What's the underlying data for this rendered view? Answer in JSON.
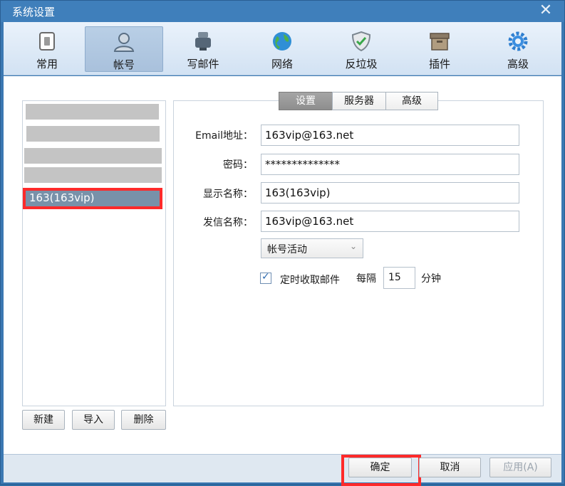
{
  "window": {
    "title": "系统设置"
  },
  "toolbar": {
    "items": [
      {
        "label": "常用",
        "icon": "switch-icon"
      },
      {
        "label": "帐号",
        "icon": "user-icon"
      },
      {
        "label": "写邮件",
        "icon": "pen-icon"
      },
      {
        "label": "网络",
        "icon": "globe-icon"
      },
      {
        "label": "反垃圾",
        "icon": "shield-icon"
      },
      {
        "label": "插件",
        "icon": "box-icon"
      },
      {
        "label": "高级",
        "icon": "gear-icon"
      }
    ],
    "active_index": 1
  },
  "accounts": {
    "selected": "163(163vip)",
    "buttons": {
      "new": "新建",
      "import": "导入",
      "delete": "删除"
    }
  },
  "settings": {
    "tabs": [
      "设置",
      "服务器",
      "高级"
    ],
    "active_tab": 0,
    "fields": {
      "email_label": "Email地址：",
      "email_value": "163vip@163.net",
      "password_label": "密码：",
      "password_value": "**************",
      "display_label": "显示名称：",
      "display_value": "163(163vip)",
      "sender_label": "发信名称：",
      "sender_value": "163vip@163.net"
    },
    "status_select": "帐号活动",
    "auto_fetch": {
      "checked": true,
      "label": "定时收取邮件",
      "every_label": "每隔",
      "interval": "15",
      "unit": "分钟"
    }
  },
  "footer": {
    "ok": "确定",
    "cancel": "取消",
    "apply": "应用(A)"
  },
  "colors": {
    "title_bar": "#3f7fbb",
    "selection": "#7891a9",
    "highlight": "#ff2a2a"
  }
}
